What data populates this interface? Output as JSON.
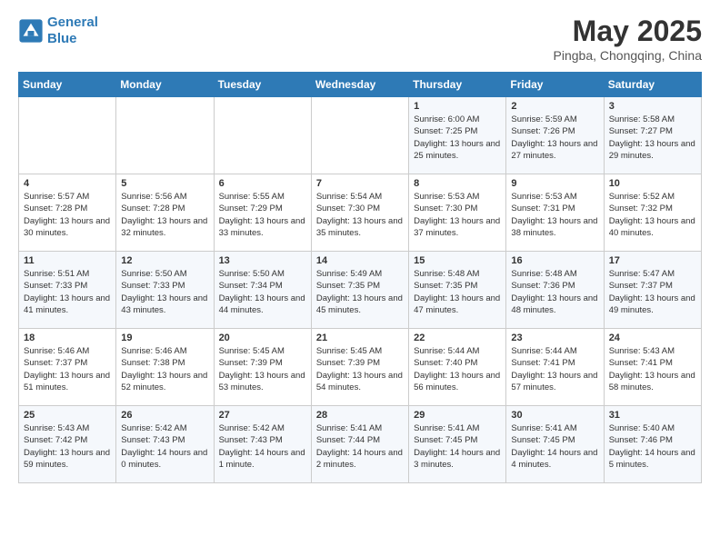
{
  "header": {
    "logo_line1": "General",
    "logo_line2": "Blue",
    "month_title": "May 2025",
    "subtitle": "Pingba, Chongqing, China"
  },
  "weekdays": [
    "Sunday",
    "Monday",
    "Tuesday",
    "Wednesday",
    "Thursday",
    "Friday",
    "Saturday"
  ],
  "weeks": [
    [
      {
        "day": "",
        "sunrise": "",
        "sunset": "",
        "daylight": ""
      },
      {
        "day": "",
        "sunrise": "",
        "sunset": "",
        "daylight": ""
      },
      {
        "day": "",
        "sunrise": "",
        "sunset": "",
        "daylight": ""
      },
      {
        "day": "",
        "sunrise": "",
        "sunset": "",
        "daylight": ""
      },
      {
        "day": "1",
        "sunrise": "Sunrise: 6:00 AM",
        "sunset": "Sunset: 7:25 PM",
        "daylight": "Daylight: 13 hours and 25 minutes."
      },
      {
        "day": "2",
        "sunrise": "Sunrise: 5:59 AM",
        "sunset": "Sunset: 7:26 PM",
        "daylight": "Daylight: 13 hours and 27 minutes."
      },
      {
        "day": "3",
        "sunrise": "Sunrise: 5:58 AM",
        "sunset": "Sunset: 7:27 PM",
        "daylight": "Daylight: 13 hours and 29 minutes."
      }
    ],
    [
      {
        "day": "4",
        "sunrise": "Sunrise: 5:57 AM",
        "sunset": "Sunset: 7:28 PM",
        "daylight": "Daylight: 13 hours and 30 minutes."
      },
      {
        "day": "5",
        "sunrise": "Sunrise: 5:56 AM",
        "sunset": "Sunset: 7:28 PM",
        "daylight": "Daylight: 13 hours and 32 minutes."
      },
      {
        "day": "6",
        "sunrise": "Sunrise: 5:55 AM",
        "sunset": "Sunset: 7:29 PM",
        "daylight": "Daylight: 13 hours and 33 minutes."
      },
      {
        "day": "7",
        "sunrise": "Sunrise: 5:54 AM",
        "sunset": "Sunset: 7:30 PM",
        "daylight": "Daylight: 13 hours and 35 minutes."
      },
      {
        "day": "8",
        "sunrise": "Sunrise: 5:53 AM",
        "sunset": "Sunset: 7:30 PM",
        "daylight": "Daylight: 13 hours and 37 minutes."
      },
      {
        "day": "9",
        "sunrise": "Sunrise: 5:53 AM",
        "sunset": "Sunset: 7:31 PM",
        "daylight": "Daylight: 13 hours and 38 minutes."
      },
      {
        "day": "10",
        "sunrise": "Sunrise: 5:52 AM",
        "sunset": "Sunset: 7:32 PM",
        "daylight": "Daylight: 13 hours and 40 minutes."
      }
    ],
    [
      {
        "day": "11",
        "sunrise": "Sunrise: 5:51 AM",
        "sunset": "Sunset: 7:33 PM",
        "daylight": "Daylight: 13 hours and 41 minutes."
      },
      {
        "day": "12",
        "sunrise": "Sunrise: 5:50 AM",
        "sunset": "Sunset: 7:33 PM",
        "daylight": "Daylight: 13 hours and 43 minutes."
      },
      {
        "day": "13",
        "sunrise": "Sunrise: 5:50 AM",
        "sunset": "Sunset: 7:34 PM",
        "daylight": "Daylight: 13 hours and 44 minutes."
      },
      {
        "day": "14",
        "sunrise": "Sunrise: 5:49 AM",
        "sunset": "Sunset: 7:35 PM",
        "daylight": "Daylight: 13 hours and 45 minutes."
      },
      {
        "day": "15",
        "sunrise": "Sunrise: 5:48 AM",
        "sunset": "Sunset: 7:35 PM",
        "daylight": "Daylight: 13 hours and 47 minutes."
      },
      {
        "day": "16",
        "sunrise": "Sunrise: 5:48 AM",
        "sunset": "Sunset: 7:36 PM",
        "daylight": "Daylight: 13 hours and 48 minutes."
      },
      {
        "day": "17",
        "sunrise": "Sunrise: 5:47 AM",
        "sunset": "Sunset: 7:37 PM",
        "daylight": "Daylight: 13 hours and 49 minutes."
      }
    ],
    [
      {
        "day": "18",
        "sunrise": "Sunrise: 5:46 AM",
        "sunset": "Sunset: 7:37 PM",
        "daylight": "Daylight: 13 hours and 51 minutes."
      },
      {
        "day": "19",
        "sunrise": "Sunrise: 5:46 AM",
        "sunset": "Sunset: 7:38 PM",
        "daylight": "Daylight: 13 hours and 52 minutes."
      },
      {
        "day": "20",
        "sunrise": "Sunrise: 5:45 AM",
        "sunset": "Sunset: 7:39 PM",
        "daylight": "Daylight: 13 hours and 53 minutes."
      },
      {
        "day": "21",
        "sunrise": "Sunrise: 5:45 AM",
        "sunset": "Sunset: 7:39 PM",
        "daylight": "Daylight: 13 hours and 54 minutes."
      },
      {
        "day": "22",
        "sunrise": "Sunrise: 5:44 AM",
        "sunset": "Sunset: 7:40 PM",
        "daylight": "Daylight: 13 hours and 56 minutes."
      },
      {
        "day": "23",
        "sunrise": "Sunrise: 5:44 AM",
        "sunset": "Sunset: 7:41 PM",
        "daylight": "Daylight: 13 hours and 57 minutes."
      },
      {
        "day": "24",
        "sunrise": "Sunrise: 5:43 AM",
        "sunset": "Sunset: 7:41 PM",
        "daylight": "Daylight: 13 hours and 58 minutes."
      }
    ],
    [
      {
        "day": "25",
        "sunrise": "Sunrise: 5:43 AM",
        "sunset": "Sunset: 7:42 PM",
        "daylight": "Daylight: 13 hours and 59 minutes."
      },
      {
        "day": "26",
        "sunrise": "Sunrise: 5:42 AM",
        "sunset": "Sunset: 7:43 PM",
        "daylight": "Daylight: 14 hours and 0 minutes."
      },
      {
        "day": "27",
        "sunrise": "Sunrise: 5:42 AM",
        "sunset": "Sunset: 7:43 PM",
        "daylight": "Daylight: 14 hours and 1 minute."
      },
      {
        "day": "28",
        "sunrise": "Sunrise: 5:41 AM",
        "sunset": "Sunset: 7:44 PM",
        "daylight": "Daylight: 14 hours and 2 minutes."
      },
      {
        "day": "29",
        "sunrise": "Sunrise: 5:41 AM",
        "sunset": "Sunset: 7:45 PM",
        "daylight": "Daylight: 14 hours and 3 minutes."
      },
      {
        "day": "30",
        "sunrise": "Sunrise: 5:41 AM",
        "sunset": "Sunset: 7:45 PM",
        "daylight": "Daylight: 14 hours and 4 minutes."
      },
      {
        "day": "31",
        "sunrise": "Sunrise: 5:40 AM",
        "sunset": "Sunset: 7:46 PM",
        "daylight": "Daylight: 14 hours and 5 minutes."
      }
    ]
  ]
}
